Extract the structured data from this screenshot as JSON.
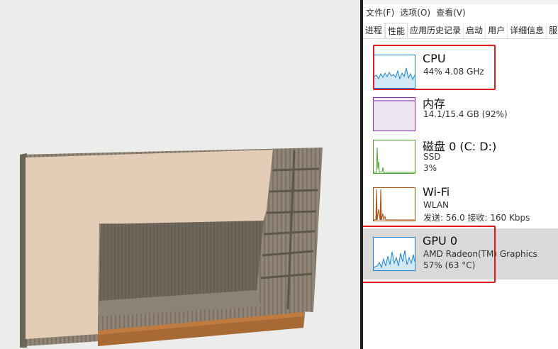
{
  "menu": [
    "文件(F)",
    "选项(O)",
    "查看(V)"
  ],
  "tabs": [
    "进程",
    "性能",
    "应用历史记录",
    "启动",
    "用户",
    "详细信息",
    "服"
  ],
  "active_tab": "性能",
  "resources": [
    {
      "title": "CPU",
      "line1": "44%  4.08 GHz",
      "line2": "",
      "color": "#1a85d6"
    },
    {
      "title": "内存",
      "line1": "14.1/15.4 GB (92%)",
      "line2": "",
      "color": "#8a2fb3"
    },
    {
      "title": "磁盘 0 (C: D:)",
      "line1": "SSD",
      "line2": "3%",
      "color": "#4ca52c"
    },
    {
      "title": "Wi-Fi",
      "line1": "WLAN",
      "line2": "发送: 56.0  接收: 160 Kbps",
      "color": "#a9541a"
    },
    {
      "title": "GPU 0",
      "line1": "AMD Radeon(TM) Graphics",
      "line2": "57%  (63 °C)",
      "color": "#1a85d6"
    }
  ],
  "selected_resource": "GPU 0",
  "highlight_color": "#e0191c"
}
